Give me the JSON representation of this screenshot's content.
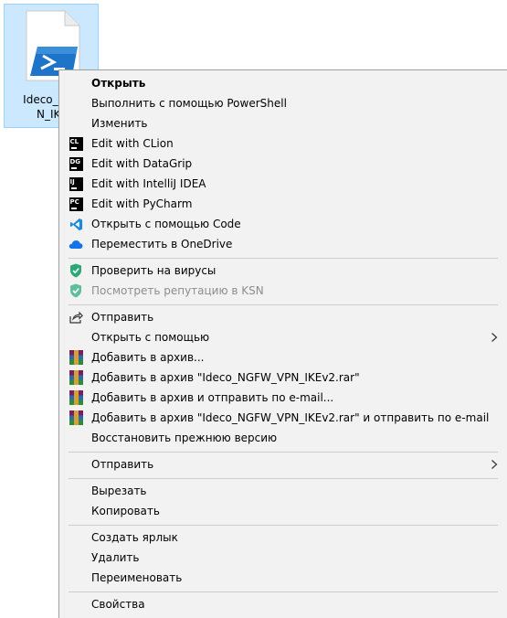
{
  "desktop": {
    "file": {
      "label_line1": "Ideco_NGF",
      "label_line2": "N_IKE"
    }
  },
  "menu": {
    "items": [
      {
        "label": "Открыть",
        "icon": "none"
      },
      {
        "label": "Выполнить с помощью PowerShell",
        "icon": "none"
      },
      {
        "label": "Изменить",
        "icon": "none"
      },
      {
        "label": "Edit with CLion",
        "icon": "clion-icon"
      },
      {
        "label": "Edit with DataGrip",
        "icon": "datagrip-icon"
      },
      {
        "label": "Edit with IntelliJ IDEA",
        "icon": "intellij-icon"
      },
      {
        "label": "Edit with PyCharm",
        "icon": "pycharm-icon"
      },
      {
        "label": "Открыть с помощью Code",
        "icon": "vscode-icon"
      },
      {
        "label": "Переместить в OneDrive",
        "icon": "onedrive-icon"
      },
      {
        "label": "Проверить на вирусы",
        "icon": "kaspersky-shield-icon"
      },
      {
        "label": "Посмотреть репутацию в KSN",
        "icon": "kaspersky-shield-icon"
      },
      {
        "label": "Отправить",
        "icon": "share-icon"
      },
      {
        "label": "Открыть с помощью",
        "icon": "none"
      },
      {
        "label": "Добавить в архив...",
        "icon": "winrar-icon"
      },
      {
        "label": "Добавить в архив \"Ideco_NGFW_VPN_IKEv2.rar\"",
        "icon": "winrar-icon"
      },
      {
        "label": "Добавить в архив и отправить по e-mail...",
        "icon": "winrar-icon"
      },
      {
        "label": "Добавить в архив \"Ideco_NGFW_VPN_IKEv2.rar\" и отправить по e-mail",
        "icon": "winrar-icon"
      },
      {
        "label": "Восстановить прежнюю версию",
        "icon": "none"
      },
      {
        "label": "Отправить",
        "icon": "none"
      },
      {
        "label": "Вырезать",
        "icon": "none"
      },
      {
        "label": "Копировать",
        "icon": "none"
      },
      {
        "label": "Создать ярлык",
        "icon": "none"
      },
      {
        "label": "Удалить",
        "icon": "none"
      },
      {
        "label": "Переименовать",
        "icon": "none"
      },
      {
        "label": "Свойства",
        "icon": "none"
      }
    ],
    "jetbrains_badges": {
      "clion": "CL",
      "datagrip": "DG",
      "intellij": "IJ",
      "pycharm": "PC"
    },
    "colors": {
      "menu_bg": "#f2f2f2",
      "disabled_text": "#8d8d8d",
      "selection_bg": "#cce8ff",
      "kaspersky_green": "#2aa876",
      "vscode_blue": "#1e88d9",
      "onedrive_blue": "#1473e6"
    }
  }
}
